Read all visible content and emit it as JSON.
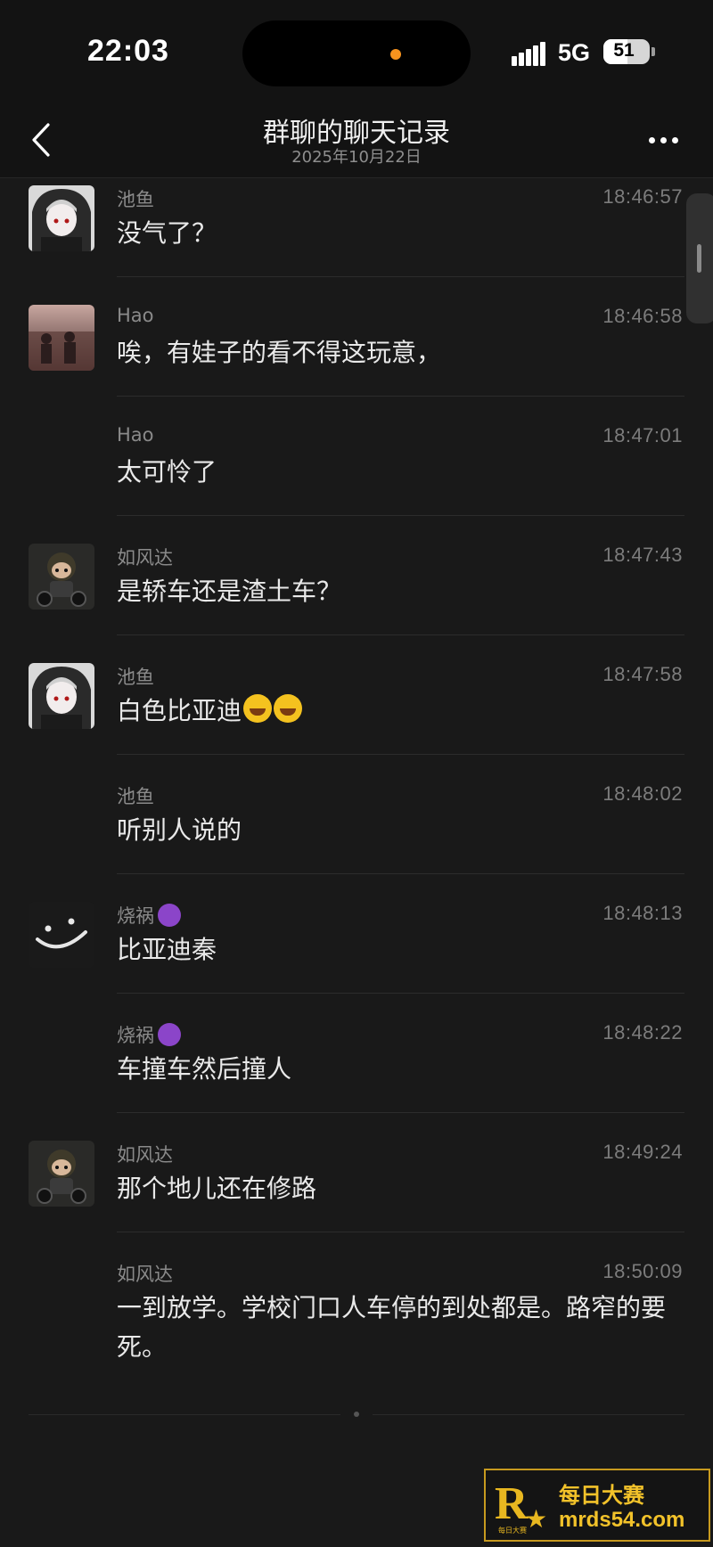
{
  "status": {
    "time": "22:03",
    "network": "5G",
    "battery": "51",
    "battery_level": 0.51
  },
  "header": {
    "title": "群聊的聊天记录",
    "subtitle": "2025年10月22日"
  },
  "messages": [
    {
      "sender": "池鱼",
      "time": "18:46:57",
      "text": "没气了？",
      "avatar": "chiyu"
    },
    {
      "sender": "Hao",
      "time": "18:46:58",
      "text": "唉，有娃子的看不得这玩意，",
      "avatar": "hao"
    },
    {
      "sender": "Hao",
      "time": "18:47:01",
      "text": "太可怜了",
      "avatar": ""
    },
    {
      "sender": "如风达",
      "time": "18:47:43",
      "text": "是轿车还是渣土车？",
      "avatar": "rufengda"
    },
    {
      "sender": "池鱼",
      "time": "18:47:58",
      "text": "白色比亚迪",
      "emoji": "😂😂",
      "avatar": "chiyu"
    },
    {
      "sender": "池鱼",
      "time": "18:48:02",
      "text": "听别人说的",
      "avatar": ""
    },
    {
      "sender": "烧祸",
      "time": "18:48:13",
      "text": "比亚迪秦",
      "avatar": "shaohuo",
      "badge": "devil-emoji"
    },
    {
      "sender": "烧祸",
      "time": "18:48:22",
      "text": "车撞车然后撞人",
      "avatar": "",
      "badge": "devil-emoji"
    },
    {
      "sender": "如风达",
      "time": "18:49:24",
      "text": "那个地儿还在修路",
      "avatar": "rufengda"
    },
    {
      "sender": "如风达",
      "time": "18:50:09",
      "text": "一到放学。学校门口人车停的到处都是。路窄的要死。",
      "avatar": ""
    }
  ],
  "watermark": {
    "line1": "每日大赛",
    "line2": "mrds54.com",
    "logo_letter": "R",
    "logo_small": "每日大赛"
  },
  "icons": {
    "back": "chevron-left-icon",
    "more": "more-dots-icon"
  },
  "colors": {
    "background": "#191919",
    "bar": "#131313",
    "text": "#e9e9e9",
    "meta": "#8a8a8a",
    "watermark": "#e8b720"
  }
}
